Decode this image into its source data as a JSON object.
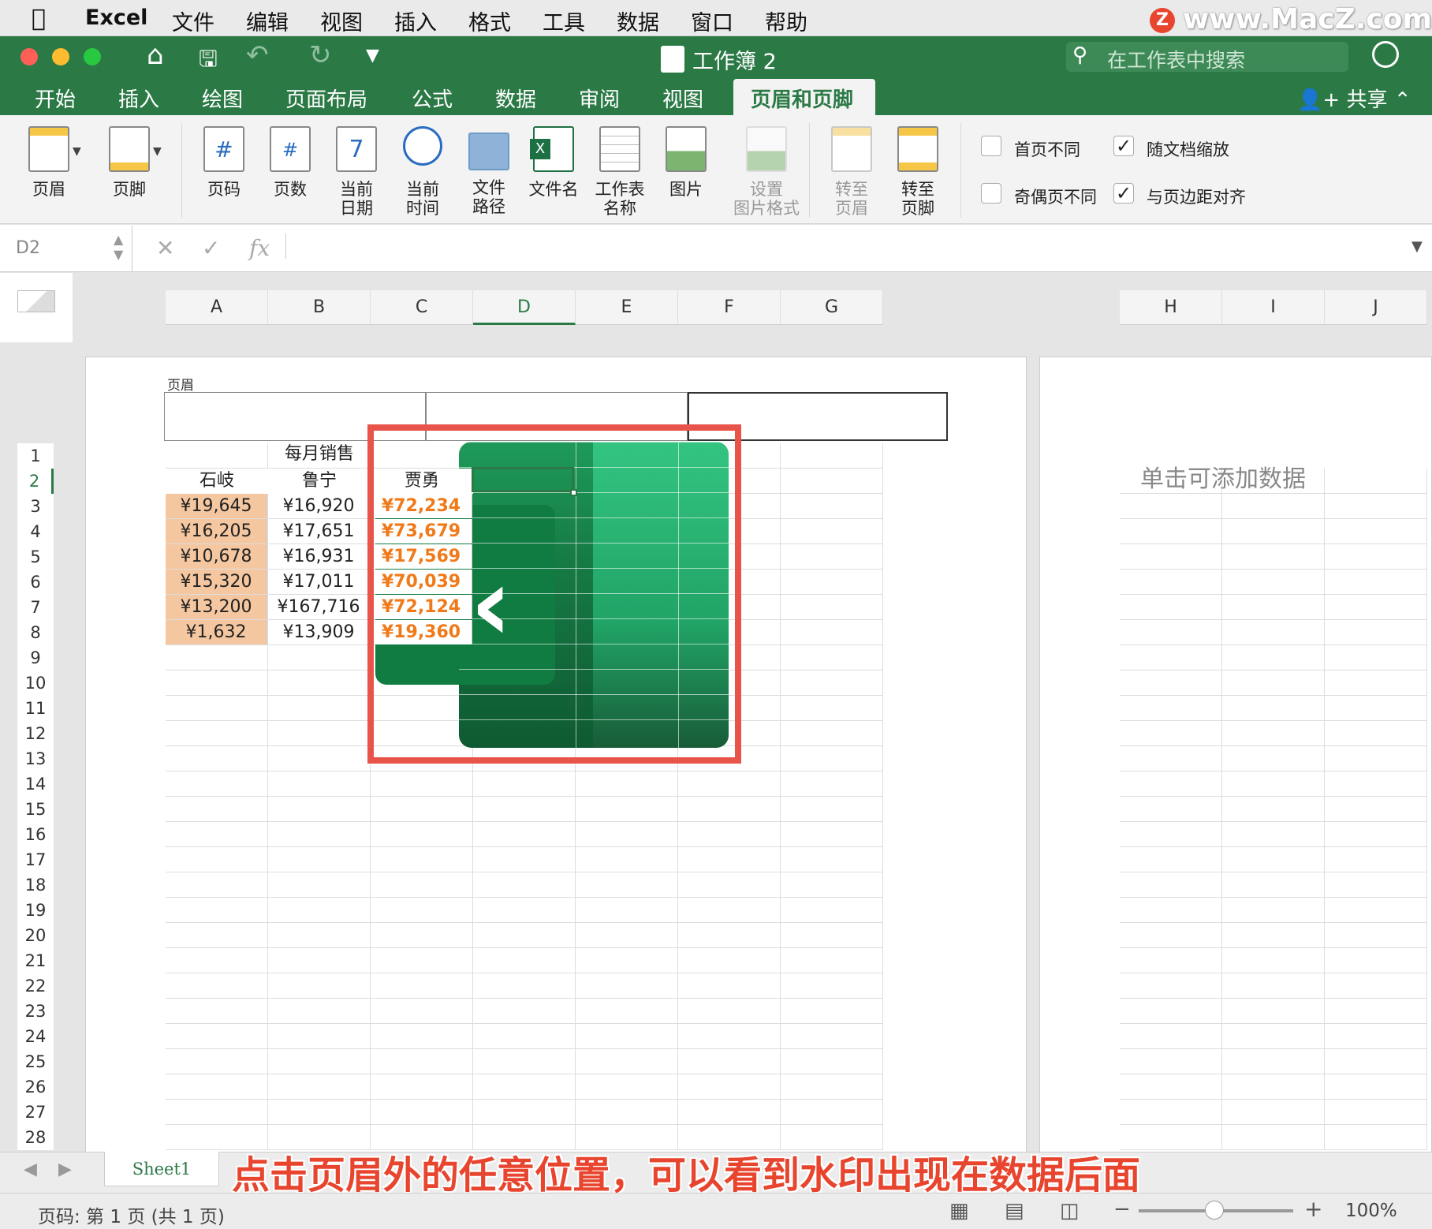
{
  "menubar": {
    "app": "Excel",
    "items": [
      "文件",
      "编辑",
      "视图",
      "插入",
      "格式",
      "工具",
      "数据",
      "窗口",
      "帮助"
    ],
    "watermark": "www.MacZ.com",
    "wm_z": "Z"
  },
  "window": {
    "title": "工作簿 2",
    "search_placeholder": "在工作表中搜索",
    "share": "共享"
  },
  "tabs": [
    "开始",
    "插入",
    "绘图",
    "页面布局",
    "公式",
    "数据",
    "审阅",
    "视图",
    "页眉和页脚"
  ],
  "active_tab": "页眉和页脚",
  "ribbon": {
    "header": "页眉",
    "footer": "页脚",
    "page_number": "页码",
    "page_count": "页数",
    "current_date": "当前\n日期",
    "current_time": "当前\n时间",
    "file_path": "文件\n路径",
    "file_name": "文件名",
    "sheet_name": "工作表\n名称",
    "picture": "图片",
    "format_picture": "设置\n图片格式",
    "goto_header": "转至\n页眉",
    "goto_footer": "转至\n页脚",
    "date_icon": "7",
    "checks": [
      {
        "label": "首页不同",
        "checked": false
      },
      {
        "label": "随文档缩放",
        "checked": true
      },
      {
        "label": "奇偶页不同",
        "checked": false
      },
      {
        "label": "与页边距对齐",
        "checked": true
      }
    ]
  },
  "formula_bar": {
    "cell_ref": "D2",
    "fx": "fx"
  },
  "columns": [
    "A",
    "B",
    "C",
    "D",
    "E",
    "F",
    "G",
    "H",
    "I",
    "J"
  ],
  "rows": [
    "1",
    "2",
    "3",
    "4",
    "5",
    "6",
    "7",
    "8",
    "9",
    "10",
    "11",
    "12",
    "13",
    "14",
    "15",
    "16",
    "17",
    "18",
    "19",
    "20",
    "21",
    "22",
    "23",
    "24",
    "25",
    "26",
    "27",
    "28"
  ],
  "header_label": "页眉",
  "table": {
    "title": "每月销售",
    "headers": [
      "石岐",
      "鲁宁",
      "贾勇"
    ],
    "rows": [
      [
        "¥19,645",
        "¥16,920",
        "¥72,234"
      ],
      [
        "¥16,205",
        "¥17,651",
        "¥73,679"
      ],
      [
        "¥10,678",
        "¥16,931",
        "¥17,569"
      ],
      [
        "¥15,320",
        "¥17,011",
        "¥70,039"
      ],
      [
        "¥13,200",
        "¥167,716",
        "¥72,124"
      ],
      [
        "¥1,632",
        "¥13,909",
        "¥19,360"
      ]
    ]
  },
  "right_page_hint": "单击可添加数据",
  "sheet_tab": "Sheet1",
  "caption": "点击页眉外的任意位置，可以看到水印出现在数据后面",
  "status": {
    "page": "页码: 第 1 页 (共 1 页)",
    "zoom": "100%"
  },
  "colors": {
    "excel_green": "#2b7a46",
    "highlight_orange": "#f5c7a0",
    "value_orange": "#f07a1a",
    "annotation_red": "#e8534a"
  }
}
